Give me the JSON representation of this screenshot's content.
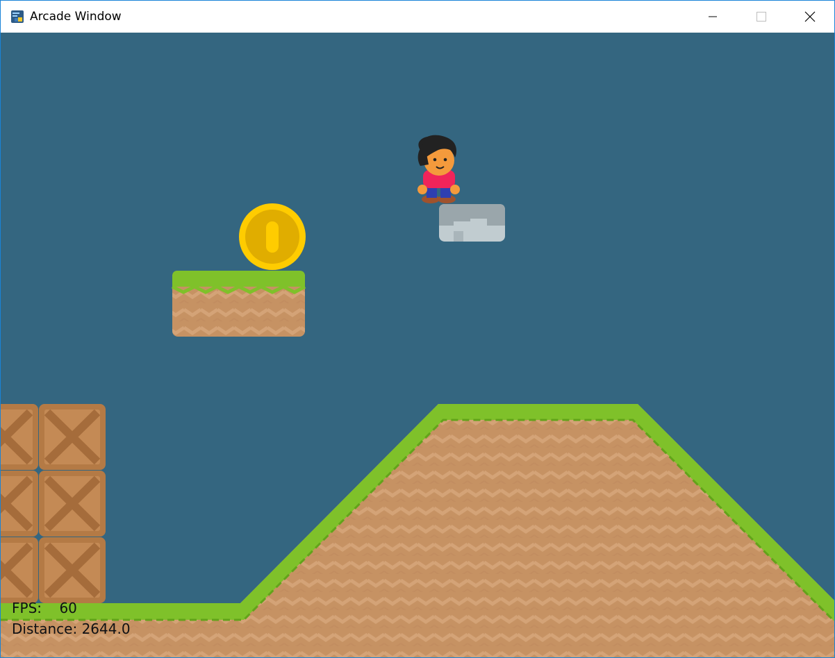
{
  "window": {
    "title": "Arcade Window",
    "controls": [
      "minimize",
      "maximize",
      "close"
    ]
  },
  "game": {
    "background_color": "#346680",
    "hud": {
      "fps_label": "FPS:",
      "fps_value": "60",
      "distance_label": "Distance:",
      "distance_value": "2644.0"
    },
    "colors": {
      "grass": "#7fc12a",
      "dirt": "#c69263",
      "dirt_zigzag": "#d4a377",
      "coin": "#ffcc00",
      "coin_inner": "#e0ad00",
      "crate": "#b47a45",
      "stone": "#c1ccd0",
      "player_shirt": "#f0245a"
    },
    "sprites": [
      "player-character",
      "gold-coin",
      "floating-grass-platform",
      "floating-stone-block",
      "crate-stack",
      "grass-hill",
      "ground"
    ]
  }
}
